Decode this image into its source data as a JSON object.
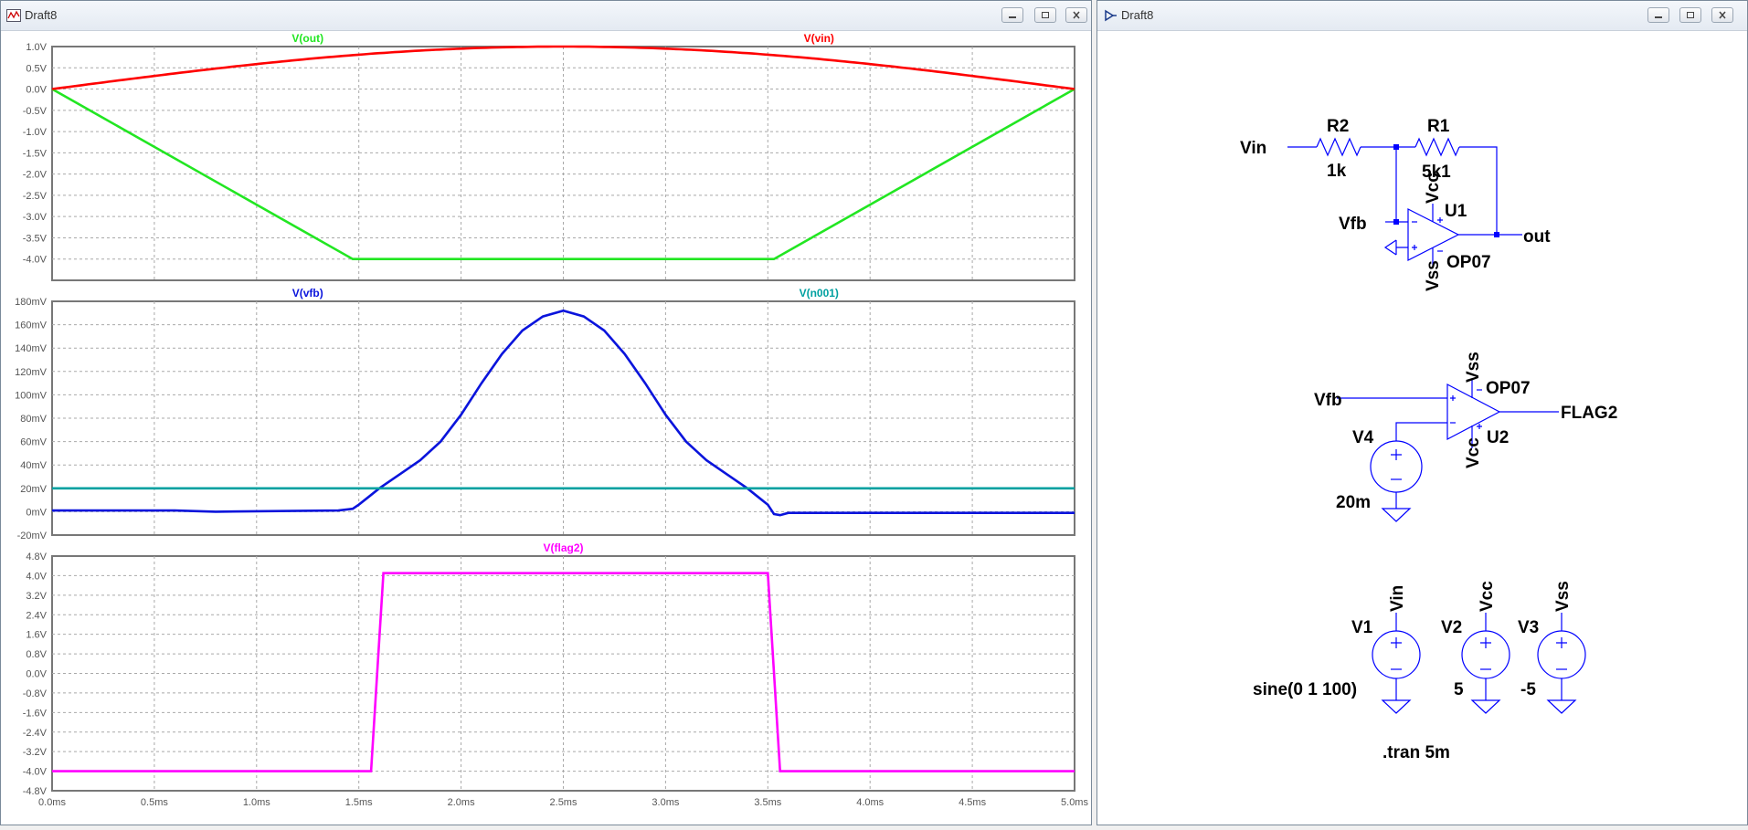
{
  "left_window": {
    "title": "Draft8",
    "panes": [
      {
        "ymin": -4.5,
        "ymax": 1.0,
        "yticks": [
          1.0,
          0.5,
          0.0,
          -0.5,
          -1.0,
          -1.5,
          -2.0,
          -2.5,
          -3.0,
          -3.5,
          -4.0
        ],
        "ytick_labels": [
          "1.0V",
          "0.5V",
          "0.0V",
          "-0.5V",
          "-1.0V",
          "-1.5V",
          "-2.0V",
          "-2.5V",
          "-3.0V",
          "-3.5V",
          "-4.0V"
        ],
        "traces": [
          {
            "name": "V(out)",
            "color": "#22e622",
            "label_x_ms": 1.25,
            "points": [
              [
                0,
                0
              ],
              [
                1.47,
                -4.0
              ],
              [
                3.53,
                -4.0
              ],
              [
                5.0,
                0
              ]
            ]
          },
          {
            "name": "V(vin)",
            "color": "#ff0000",
            "label_x_ms": 3.75,
            "sine": {
              "amp": 1.0,
              "freq_hz": 100
            }
          }
        ]
      },
      {
        "ymin": -20,
        "ymax": 180,
        "yticks": [
          180,
          160,
          140,
          120,
          100,
          80,
          60,
          40,
          20,
          0,
          -20
        ],
        "ytick_labels": [
          "180mV",
          "160mV",
          "140mV",
          "120mV",
          "100mV",
          "80mV",
          "60mV",
          "40mV",
          "20mV",
          "0mV",
          "-20mV"
        ],
        "traces": [
          {
            "name": "V(vfb)",
            "color": "#0a14dc",
            "label_x_ms": 1.25,
            "points": [
              [
                0,
                1
              ],
              [
                0.6,
                1
              ],
              [
                0.8,
                0
              ],
              [
                1.4,
                1
              ],
              [
                1.47,
                2.5
              ],
              [
                1.5,
                6
              ],
              [
                1.55,
                13
              ],
              [
                1.6,
                20
              ],
              [
                1.7,
                32
              ],
              [
                1.8,
                44
              ],
              [
                1.9,
                60
              ],
              [
                2.0,
                83
              ],
              [
                2.1,
                110
              ],
              [
                2.2,
                135
              ],
              [
                2.3,
                155
              ],
              [
                2.4,
                167
              ],
              [
                2.5,
                172
              ],
              [
                2.6,
                167
              ],
              [
                2.7,
                155
              ],
              [
                2.8,
                135
              ],
              [
                2.9,
                110
              ],
              [
                3.0,
                83
              ],
              [
                3.1,
                60
              ],
              [
                3.2,
                44
              ],
              [
                3.3,
                32
              ],
              [
                3.4,
                20
              ],
              [
                3.45,
                13
              ],
              [
                3.5,
                6
              ],
              [
                3.53,
                -2
              ],
              [
                3.56,
                -3
              ],
              [
                3.6,
                -1
              ],
              [
                5.0,
                -1
              ]
            ]
          },
          {
            "name": "V(n001)",
            "color": "#00a0a0",
            "label_x_ms": 3.75,
            "points": [
              [
                0,
                20
              ],
              [
                5.0,
                20
              ]
            ]
          }
        ]
      },
      {
        "ymin": -4.8,
        "ymax": 4.8,
        "yticks": [
          4.8,
          4.0,
          3.2,
          2.4,
          1.6,
          0.8,
          0.0,
          -0.8,
          -1.6,
          -2.4,
          -3.2,
          -4.0,
          -4.8
        ],
        "ytick_labels": [
          "4.8V",
          "4.0V",
          "3.2V",
          "2.4V",
          "1.6V",
          "0.8V",
          "0.0V",
          "-0.8V",
          "-1.6V",
          "-2.4V",
          "-3.2V",
          "-4.0V",
          "-4.8V"
        ],
        "traces": [
          {
            "name": "V(flag2)",
            "color": "#ff00ff",
            "label_x_ms": 2.5,
            "points": [
              [
                0,
                -4.0
              ],
              [
                1.56,
                -4.0
              ],
              [
                1.62,
                4.1
              ],
              [
                3.5,
                4.1
              ],
              [
                3.56,
                -4.0
              ],
              [
                5.0,
                -4.0
              ]
            ]
          }
        ]
      }
    ],
    "x_axis": {
      "xmin": 0,
      "xmax": 5.0,
      "ticks": [
        0,
        0.5,
        1.0,
        1.5,
        2.0,
        2.5,
        3.0,
        3.5,
        4.0,
        4.5,
        5.0
      ],
      "tick_labels": [
        "0.0ms",
        "0.5ms",
        "1.0ms",
        "1.5ms",
        "2.0ms",
        "2.5ms",
        "3.0ms",
        "3.5ms",
        "4.0ms",
        "4.5ms",
        "5.0ms"
      ]
    }
  },
  "right_window": {
    "title": "Draft8",
    "labels": {
      "vin": "Vin",
      "r2": "R2",
      "r2_val": "1k",
      "r1": "R1",
      "r1_val": "5k1",
      "vcc_u1": "Vcc",
      "u1": "U1",
      "vfb_u1": "Vfb",
      "out": "out",
      "op07_u1": "OP07",
      "vss_u1": "Vss",
      "vss_u2": "Vss",
      "op07_u2": "OP07",
      "vfb_u2": "Vfb",
      "flag2": "FLAG2",
      "v4": "V4",
      "u2": "U2",
      "vcc_u2": "Vcc",
      "v4_val": "20m",
      "v1": "V1",
      "v1_net": "Vin",
      "v1_val": "sine(0 1 100)",
      "v2": "V2",
      "v2_net": "Vcc",
      "v2_val": "5",
      "v3": "V3",
      "v3_net": "Vss",
      "v3_val": "-5",
      "tran": ".tran 5m"
    }
  },
  "colors": {
    "wire": "#0000ff",
    "grid": "#a9a9a9",
    "axis_text": "#555555",
    "schematic_text": "#000000"
  }
}
